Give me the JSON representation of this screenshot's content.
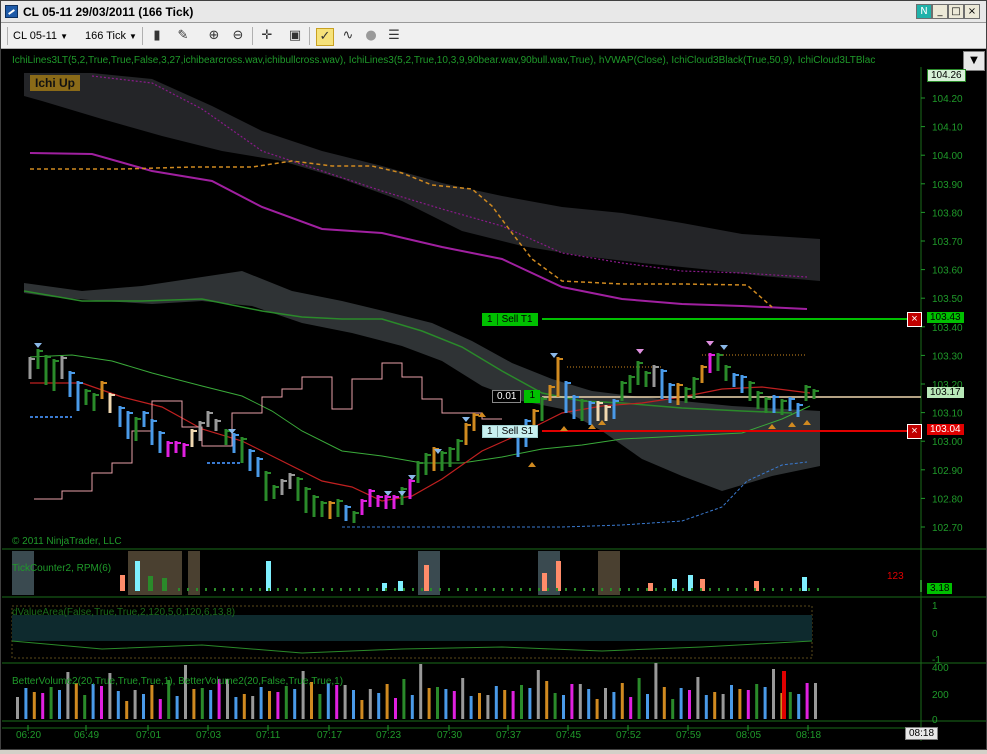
{
  "window": {
    "title": "CL 05-11  29/03/2011 (166 Tick)",
    "controls": [
      "N",
      "_",
      "□",
      "×"
    ]
  },
  "toolbar": {
    "instrument": "CL 05-11",
    "interval": "166 Tick"
  },
  "indicators_label": "IchiLines3LT(5,2,True,True,False,3,27,ichibearcross.wav,ichibullcross.wav), IchiLines3(5,2,True,10,3,9,90bear.wav,90bull.wav,True), hVWAP(Close), IchiCloud3Black(True,50,9), IchiCloud3LTBlac",
  "badge": "Ichi Up",
  "copyright": "© 2011 NinjaTrader, LLC",
  "price_axis": {
    "ticks": [
      "104.20",
      "104.10",
      "104.00",
      "103.90",
      "103.80",
      "103.70",
      "103.60",
      "103.50",
      "103.40",
      "103.30",
      "103.20",
      "103.10",
      "103.00",
      "102.90",
      "102.80",
      "102.70"
    ],
    "top_label": "104.26",
    "last_price": "103.17",
    "target_t1": "103.43",
    "stop_s1": "103.04"
  },
  "orders": {
    "t1_qty": "1",
    "t1_label": "Sell T1",
    "s1_qty": "1",
    "s1_label": "Sell S1",
    "pos_pnl": "0.01",
    "pos_qty": "1"
  },
  "panel2": {
    "label": "TickCounter2, RPM(6)",
    "count": "123",
    "value": "3.18"
  },
  "panel3": {
    "label": "dValueArea(False,True,True,2,120,5,0,120,6,13,8)",
    "ticks": [
      "1",
      "0",
      "-1"
    ]
  },
  "panel4": {
    "label": "BetterVolume2(20,True,True,True,1), BetterVolume2(20,False,True,True,1)",
    "ticks": [
      "400",
      "200",
      "0"
    ]
  },
  "time_axis": {
    "ticks": [
      "06:20",
      "06:49",
      "07:01",
      "07:03",
      "07:11",
      "07:17",
      "07:23",
      "07:30",
      "07:37",
      "07:45",
      "07:52",
      "07:59",
      "08:05",
      "08:18"
    ],
    "current": "08:18"
  },
  "colors": {
    "background": "#000000",
    "grid": "#1a6b1a",
    "target": "#00c000",
    "stop": "#e00000",
    "cloud": "#2d3032",
    "magenta": "#a020a0",
    "orange_dashed": "#d08a20"
  }
}
